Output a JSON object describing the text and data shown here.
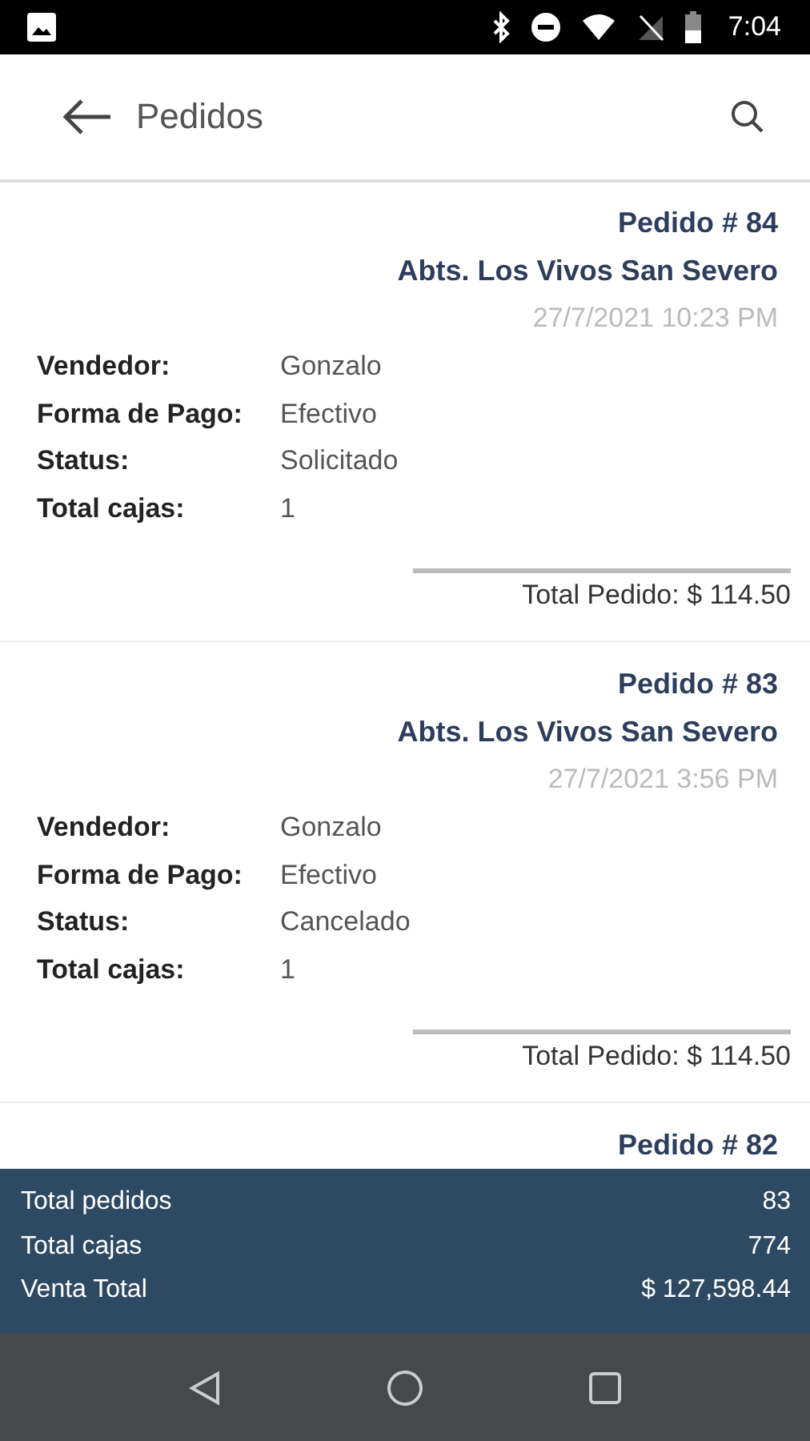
{
  "status_bar": {
    "time": "7:04"
  },
  "toolbar": {
    "title": "Pedidos"
  },
  "orders": [
    {
      "title": "Pedido # 84",
      "customer": "Abts. Los Vivos San Severo",
      "date": "27/7/2021 10:23 PM",
      "fields": [
        {
          "label": "Vendedor:",
          "value": "Gonzalo"
        },
        {
          "label": "Forma de Pago:",
          "value": "Efectivo"
        },
        {
          "label": "Status:",
          "value": "Solicitado"
        },
        {
          "label": "Total cajas:",
          "value": "1"
        }
      ],
      "total": "Total Pedido: $ 114.50"
    },
    {
      "title": "Pedido # 83",
      "customer": "Abts. Los Vivos San Severo",
      "date": "27/7/2021 3:56 PM",
      "fields": [
        {
          "label": "Vendedor:",
          "value": "Gonzalo"
        },
        {
          "label": "Forma de Pago:",
          "value": "Efectivo"
        },
        {
          "label": "Status:",
          "value": "Cancelado"
        },
        {
          "label": "Total cajas:",
          "value": "1"
        }
      ],
      "total": "Total Pedido: $ 114.50"
    },
    {
      "title": "Pedido # 82"
    }
  ],
  "summary": [
    {
      "label": "Total pedidos",
      "value": "83"
    },
    {
      "label": "Total cajas",
      "value": "774"
    },
    {
      "label": "Venta Total",
      "value": "$ 127,598.44"
    }
  ]
}
